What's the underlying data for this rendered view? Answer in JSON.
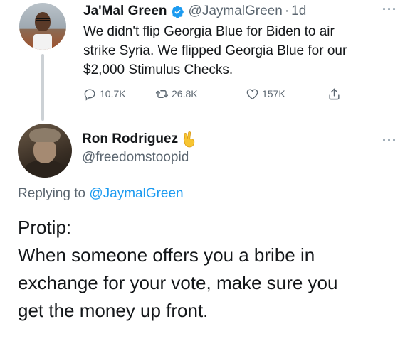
{
  "tweet1": {
    "author_name": "Ja'Mal Green",
    "handle": "@JaymalGreen",
    "separator": "·",
    "time": "1d",
    "more": "···",
    "body_lines": [
      "We didn't flip Georgia Blue for Biden to air",
      "strike Syria. We flipped Georgia Blue for our",
      "$2,000 Stimulus Checks."
    ],
    "actions": {
      "reply_count": "10.7K",
      "retweet_count": "26.8K",
      "like_count": "157K"
    },
    "verified_color": "#1d9bf0"
  },
  "tweet2": {
    "author_name": "Ron Rodriguez",
    "handle": "@freedomstoopid",
    "more": "···",
    "replying_prefix": "Replying to ",
    "replying_to": "@JaymalGreen",
    "body_lines": [
      "Protip:",
      "When someone offers you a bribe in",
      "exchange for your vote, make sure you",
      "get the money up front."
    ],
    "emoji": "victory-hand"
  },
  "colors": {
    "link": "#1d9bf0",
    "secondary_text": "#5b6670",
    "primary_text": "#14171a"
  }
}
